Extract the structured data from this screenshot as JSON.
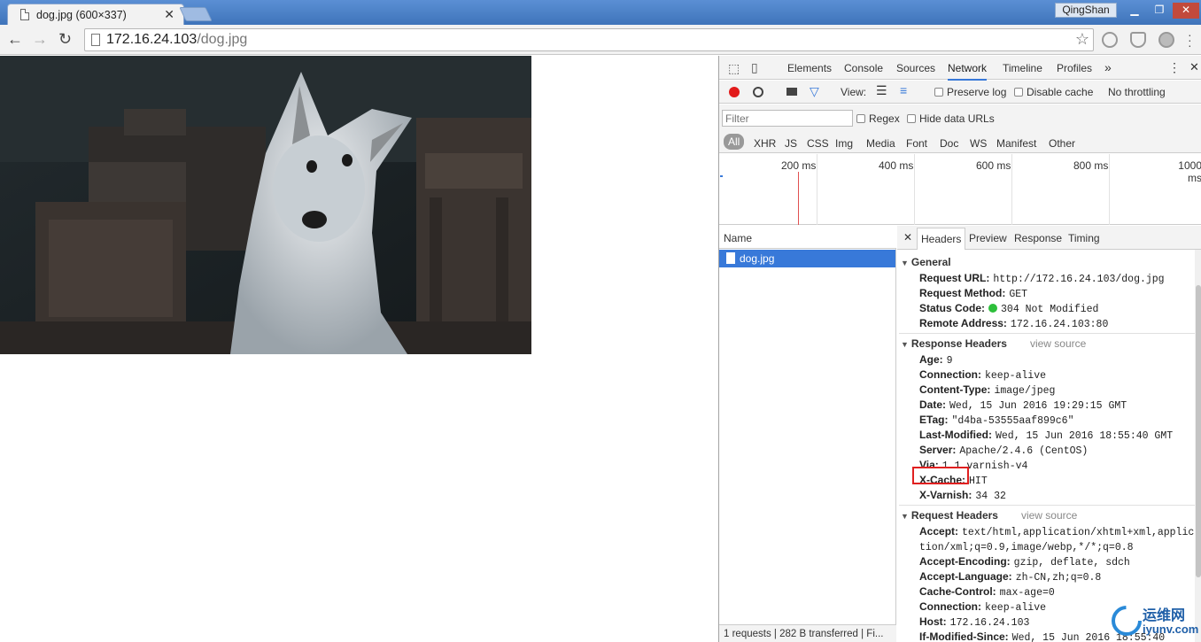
{
  "browser": {
    "tab_title": "dog.jpg (600×337)",
    "tab_close": "✕",
    "user_name": "QingShan",
    "win_min": "▁",
    "win_max": "❐",
    "win_close": "✕",
    "url_host": "172.16.24.103",
    "url_path": "/dog.jpg",
    "back_icon": "←",
    "forward_icon": "→",
    "reload_icon": "↻",
    "star_icon": "☆"
  },
  "devtools": {
    "tabs": [
      "Elements",
      "Console",
      "Sources",
      "Network",
      "Timeline",
      "Profiles"
    ],
    "more_tabs": "»",
    "menu": "⋮",
    "close": "✕",
    "active_tab": "Network",
    "toolbar": {
      "view_label": "View:",
      "preserve_log": "Preserve log",
      "disable_cache": "Disable cache",
      "throttling": "No throttling"
    },
    "filter": {
      "placeholder": "Filter",
      "regex": "Regex",
      "hide_data_urls": "Hide data URLs",
      "types": [
        "All",
        "XHR",
        "JS",
        "CSS",
        "Img",
        "Media",
        "Font",
        "Doc",
        "WS",
        "Manifest",
        "Other"
      ]
    },
    "timeline_ticks": [
      "200 ms",
      "400 ms",
      "600 ms",
      "800 ms",
      "1000 ms"
    ],
    "name_header": "Name",
    "requests": [
      {
        "name": "dog.jpg"
      }
    ],
    "status_bar": "1 requests  |  282 B transferred  |  Fi...",
    "detail_tabs": [
      "Headers",
      "Preview",
      "Response",
      "Timing"
    ],
    "detail_close": "✕",
    "active_detail_tab": "Headers",
    "general": {
      "title": "General",
      "rows": [
        {
          "k": "Request URL:",
          "v": "http://172.16.24.103/dog.jpg"
        },
        {
          "k": "Request Method:",
          "v": "GET"
        },
        {
          "k": "Status Code:",
          "v": "304 Not Modified"
        },
        {
          "k": "Remote Address:",
          "v": "172.16.24.103:80"
        }
      ],
      "status_color": "#2dbf3b"
    },
    "response_headers": {
      "title": "Response Headers",
      "view_source": "view source",
      "rows": [
        {
          "k": "Age:",
          "v": "9"
        },
        {
          "k": "Connection:",
          "v": "keep-alive"
        },
        {
          "k": "Content-Type:",
          "v": "image/jpeg"
        },
        {
          "k": "Date:",
          "v": "Wed, 15 Jun 2016 19:29:15 GMT"
        },
        {
          "k": "ETag:",
          "v": "\"d4ba-53555aaf899c6\""
        },
        {
          "k": "Last-Modified:",
          "v": "Wed, 15 Jun 2016 18:55:40 GMT"
        },
        {
          "k": "Server:",
          "v": "Apache/2.4.6 (CentOS)"
        },
        {
          "k": "Via:",
          "v": "1.1 varnish-v4"
        },
        {
          "k": "X-Cache:",
          "v": "HIT"
        },
        {
          "k": "X-Varnish:",
          "v": "34 32"
        }
      ]
    },
    "request_headers": {
      "title": "Request Headers",
      "view_source": "view source",
      "rows": [
        {
          "k": "Accept:",
          "v": "text/html,application/xhtml+xml,applica"
        },
        {
          "k": "",
          "v": "tion/xml;q=0.9,image/webp,*/*;q=0.8"
        },
        {
          "k": "Accept-Encoding:",
          "v": "gzip, deflate, sdch"
        },
        {
          "k": "Accept-Language:",
          "v": "zh-CN,zh;q=0.8"
        },
        {
          "k": "Cache-Control:",
          "v": "max-age=0"
        },
        {
          "k": "Connection:",
          "v": "keep-alive"
        },
        {
          "k": "Host:",
          "v": "172.16.24.103"
        },
        {
          "k": "If-Modified-Since:",
          "v": "Wed, 15 Jun 2016 18:55:40"
        }
      ]
    },
    "highlight_color": "#e02020"
  },
  "watermark": {
    "text": "运维网",
    "subtext": "iyunv.com"
  }
}
